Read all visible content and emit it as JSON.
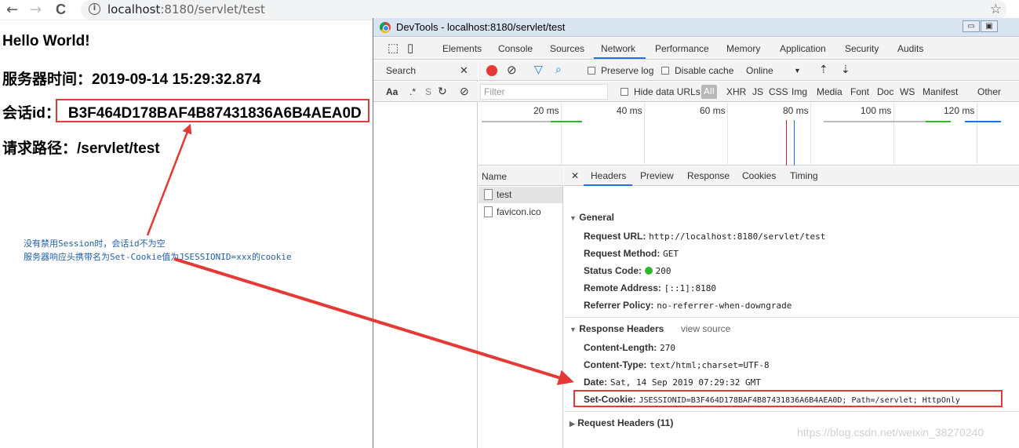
{
  "browser": {
    "back": "←",
    "forward": "→",
    "reload": "C",
    "info": "i",
    "url_host": "localhost",
    "url_rest": ":8180/servlet/test",
    "star": "☆"
  },
  "page": {
    "line1": "Hello World!",
    "line2": "服务器时间：2019-09-14 15:29:32.874",
    "line3_label": "会话id：",
    "line3_value": "B3F464D178BAF4B87431836A6B4AEA0D",
    "line4": "请求路径：/servlet/test"
  },
  "annotation": {
    "line1": "没有禁用Session时，会话id不为空",
    "line2": "服务器响应头携带名为Set-Cookie值为JSESSIONID=xxx的cookie"
  },
  "devtools": {
    "title": "DevTools - localhost:8180/servlet/test",
    "win_min": "▭",
    "win_max": "▣",
    "win_close": "✕",
    "tabs": [
      "Elements",
      "Console",
      "Sources",
      "Network",
      "Performance",
      "Memory",
      "Application",
      "Security",
      "Audits"
    ],
    "search_label": "Search",
    "search_close": "✕",
    "search_opts": [
      "Aa",
      ".*",
      "S"
    ],
    "toolbar": {
      "preserve_log": "Preserve log",
      "disable_cache": "Disable cache",
      "throttle": "Online",
      "throttle_arrow": "▼"
    },
    "filter": {
      "placeholder": "Filter",
      "hide_data_urls": "Hide data URLs",
      "all": "All",
      "types": [
        "XHR",
        "JS",
        "CSS",
        "Img",
        "Media",
        "Font",
        "Doc",
        "WS",
        "Manifest",
        "Other"
      ]
    },
    "timeline": {
      "labels": [
        "20 ms",
        "40 ms",
        "60 ms",
        "80 ms",
        "100 ms",
        "120 ms"
      ]
    },
    "requests": {
      "header": "Name",
      "items": [
        "test",
        "favicon.ico"
      ]
    },
    "detail_tabs": [
      "Headers",
      "Preview",
      "Response",
      "Cookies",
      "Timing"
    ],
    "detail_close": "✕",
    "general": {
      "title": "General",
      "rows": [
        {
          "key": "Request URL:",
          "value": "http://localhost:8180/servlet/test"
        },
        {
          "key": "Request Method:",
          "value": "GET"
        },
        {
          "key": "Status Code:",
          "value": "200"
        },
        {
          "key": "Remote Address:",
          "value": "[::1]:8180"
        },
        {
          "key": "Referrer Policy:",
          "value": "no-referrer-when-downgrade"
        }
      ]
    },
    "response_headers": {
      "title": "Response Headers",
      "view_source": "view source",
      "rows": [
        {
          "key": "Content-Length:",
          "value": "270"
        },
        {
          "key": "Content-Type:",
          "value": "text/html;charset=UTF-8"
        },
        {
          "key": "Date:",
          "value": "Sat, 14 Sep 2019 07:29:32 GMT"
        },
        {
          "key": "Set-Cookie:",
          "value": "JSESSIONID=B3F464D178BAF4B87431836A6B4AEA0D; Path=/servlet; HttpOnly"
        }
      ]
    },
    "request_headers": {
      "title": "Request Headers (11)"
    }
  },
  "watermark": "https://blog.csdn.net/weixin_38270240",
  "colors": {
    "highlight_box": "#e53935",
    "annotation_text": "#1f5fb0",
    "status_ok": "#2eb82e",
    "accent": "#1a73e8"
  }
}
